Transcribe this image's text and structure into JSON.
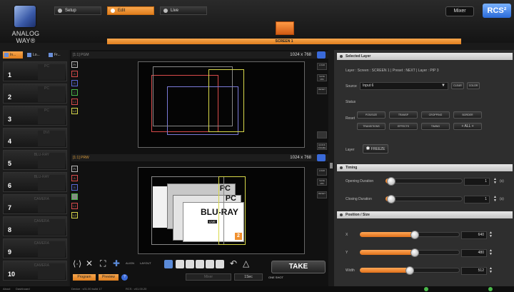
{
  "app": {
    "brand": "ANALOG WAY®",
    "rcs": "RCS²",
    "mixer": "Mixer"
  },
  "tabs": [
    {
      "label": "Setup"
    },
    {
      "label": "Edit"
    },
    {
      "label": "Live"
    }
  ],
  "screen": {
    "label": "SCREEN 1"
  },
  "left_tabs": [
    "In...",
    "Lo...",
    "Fr..."
  ],
  "inputs": [
    {
      "num": "1",
      "name": "PC"
    },
    {
      "num": "2",
      "name": "PC"
    },
    {
      "num": "3",
      "name": "PC"
    },
    {
      "num": "4",
      "name": "DVI"
    },
    {
      "num": "5",
      "name": "BLU-RAY"
    },
    {
      "num": "6",
      "name": "BLU-RAY"
    },
    {
      "num": "7",
      "name": "CAMERA"
    },
    {
      "num": "8",
      "name": "CAMERA"
    },
    {
      "num": "9",
      "name": "CAMERA"
    },
    {
      "num": "10",
      "name": "CAMERA"
    }
  ],
  "program": {
    "header": "[1:1] PGM",
    "resolution": "1024 x 768",
    "side": [
      "LOAD",
      "SAVE MM",
      "RESET"
    ],
    "freeze": "QUICK FRAME"
  },
  "preview": {
    "header": "[1:1] PRW",
    "resolution": "1024 x 768",
    "side": [
      "LOAD",
      "SAVE MM",
      "RESET"
    ],
    "labels": [
      "PC",
      "PC",
      "BLU-RAY",
      "LIVE"
    ]
  },
  "layers": [
    "Fr",
    "A",
    "B",
    "C",
    "L1",
    "L2"
  ],
  "bottom": {
    "program": "Program",
    "preview": "Preview",
    "help": "?",
    "mixer": "Mixer",
    "take": "TAKE",
    "oneshot": "ONE SHOT",
    "sec": "1Sec",
    "align": "ALIGN",
    "layout": "LAYOUT"
  },
  "selected_layer": {
    "header": "Selected Layer",
    "crumb": "Layer : Screen : SCREEN 1 | Preset : NEXT | Layer : PIP 3",
    "source_label": "Source",
    "source_value": "Input 6",
    "clear": "CLEAR",
    "color": "COLOR",
    "status_label": "Status",
    "reset_label": "Reset",
    "reset_buttons": [
      "POS/SIZE",
      "TRANSP",
      "CROPPING",
      "BORDER",
      "TRANSITIONS",
      "EFFECTS",
      "TIMING",
      "+ ALL +"
    ],
    "layer_label": "Layer",
    "freeze": "FREEZE"
  },
  "timing": {
    "header": "Timing",
    "rows": [
      {
        "label": "Opening Duration",
        "value": "1",
        "unit": "(s)",
        "level": 0.02
      },
      {
        "label": "Closing Duration",
        "value": "1",
        "unit": "(s)",
        "level": 0.02
      }
    ]
  },
  "possize": {
    "header": "Position / Size",
    "rows": [
      {
        "label": "X",
        "value": "640",
        "level": 0.55
      },
      {
        "label": "Y",
        "value": "480",
        "level": 0.55
      },
      {
        "label": "Width",
        "value": "512",
        "level": 0.5
      }
    ]
  },
  "status": {
    "about": "About",
    "dashboard": "Dashboard",
    "device": "Device : v01.00 build 17",
    "rcs": "RCS : v01.00.20"
  },
  "colors": {
    "accent": "#f0902e",
    "layerA": "#d84a4a",
    "layerB": "#5a6ad8",
    "layerC": "#4ab84a",
    "layerL1": "#d84a4a",
    "layerL2": "#d8d84a"
  }
}
